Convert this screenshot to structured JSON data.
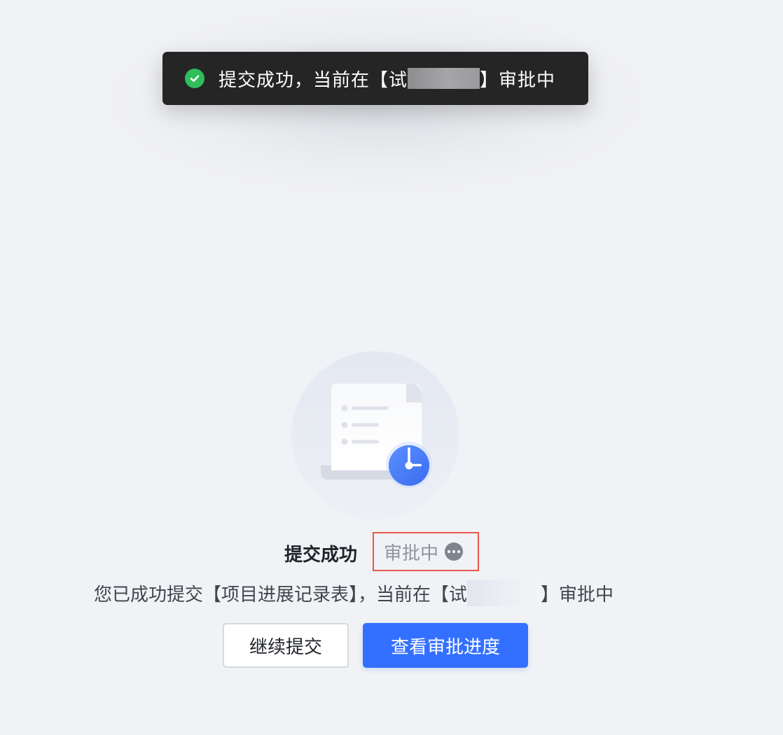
{
  "toast": {
    "prefix": "提交成功，当前在【试",
    "suffix": "】审批中",
    "icon": "check-circle-icon",
    "color": "#2fbe5a"
  },
  "status": {
    "title": "提交成功",
    "badge_label": "审批中",
    "badge_icon": "more-icon",
    "highlight_color": "#e8584a"
  },
  "description": {
    "prefix": "您已成功提交【项目进展记录表】，当前在【试",
    "suffix": "】审批中"
  },
  "actions": {
    "continue_label": "继续提交",
    "progress_label": "查看审批进度",
    "primary_color": "#3370ff"
  }
}
